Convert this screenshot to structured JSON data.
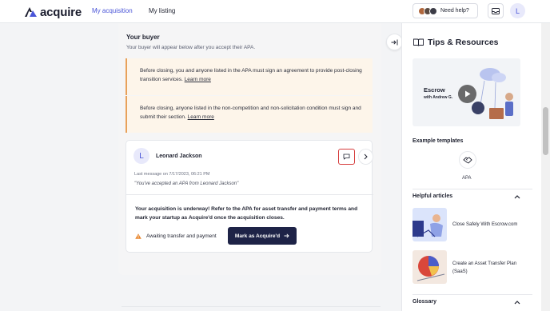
{
  "app": {
    "brand": "acquire",
    "nav": [
      {
        "label": "My acquisition",
        "active": true
      },
      {
        "label": "My listing",
        "active": false
      }
    ],
    "help_label": "Need help?",
    "user_initial": "L"
  },
  "main": {
    "section_title": "Your buyer",
    "section_subtitle": "Your buyer will appear below after you accept their APA.",
    "notices": [
      {
        "text": "Before closing, you and anyone listed in the APA must sign an agreement to provide post-closing transition services.",
        "link": "Learn more"
      },
      {
        "text": "Before closing, anyone listed in the non-competition and non-solicitation condition must sign and submit their section.",
        "link": "Learn more"
      }
    ],
    "buyer": {
      "initial": "L",
      "name": "Leonard Jackson",
      "last_message": "Last message on 7/17/2023, 06:21 PM",
      "quote": "\"You've accepted an APA from Leonard Jackson\""
    },
    "progress_text": "Your acquisition is underway! Refer to the APA for asset transfer and payment terms and mark your startup as Acquire'd once the acquisition closes.",
    "awaiting_label": "Awaiting transfer and payment",
    "mark_button": "Mark as Acquire'd"
  },
  "sidebar": {
    "title": "Tips & Resources",
    "video": {
      "title": "Escrow",
      "subtitle": "with Andrew G."
    },
    "templates_heading": "Example templates",
    "template_label": "APA",
    "articles_heading": "Helpful articles",
    "articles": [
      {
        "title": "Close Safely With Escrow.com"
      },
      {
        "title": "Create an Asset Transfer Plan (SaaS)"
      }
    ],
    "glossary_heading": "Glossary"
  },
  "colors": {
    "brand": "#4a55d8",
    "primary_button": "#1e2347",
    "notice_bg": "#fdf5ea",
    "notice_accent": "#e8a15a",
    "highlight": "#d53b3b"
  }
}
